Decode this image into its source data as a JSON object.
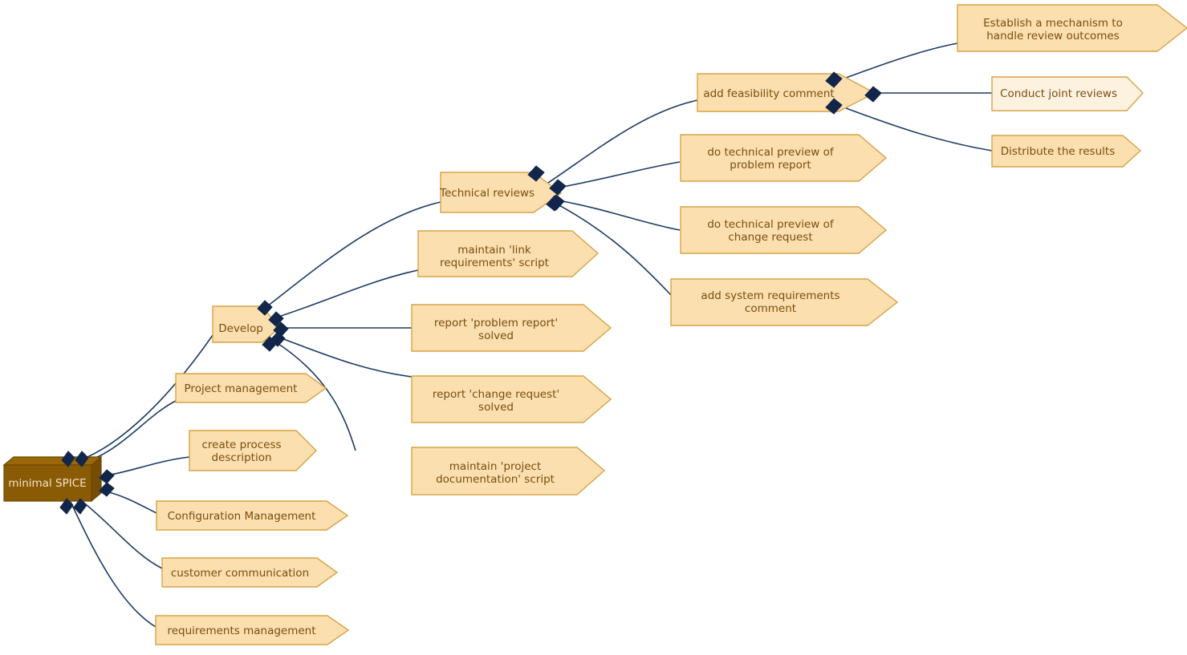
{
  "diagram": {
    "title": "minimal SPICE",
    "type": "work-breakdown-structure",
    "colors": {
      "leaf_fill": "#FBDFAF",
      "leaf_fill_light": "#FDF2E0",
      "leaf_stroke": "#D6A447",
      "leaf_text": "#7A4E10",
      "root_fill": "#8A5B05",
      "root_text": "#F3E3C8",
      "edge": "#1B3A63",
      "connector_diamond": "#12264B",
      "background": "#FFFFFF"
    },
    "nodes": {
      "root": {
        "label": "minimal SPICE"
      },
      "develop": {
        "label": "Develop"
      },
      "project_management": {
        "label": "Project management"
      },
      "create_process_description": {
        "line1": "create process",
        "line2": "description"
      },
      "configuration_management": {
        "label": "Configuration Management"
      },
      "customer_communication": {
        "label": "customer communication"
      },
      "requirements_management": {
        "label": "requirements management"
      },
      "technical_reviews": {
        "label": "Technical reviews"
      },
      "maintain_link_requirements": {
        "line1": "maintain 'link",
        "line2": "requirements' script"
      },
      "report_problem_report_solved": {
        "line1": "report 'problem report'",
        "line2": "solved"
      },
      "report_change_request_solved": {
        "line1": "report 'change request'",
        "line2": "solved"
      },
      "maintain_project_documentation": {
        "line1": "maintain 'project",
        "line2": "documentation' script"
      },
      "add_feasibility_comment": {
        "label": "add feasibility comment"
      },
      "do_technical_preview_problem_report": {
        "line1": "do technical preview of",
        "line2": "problem report"
      },
      "do_technical_preview_change_request": {
        "line1": "do technical preview of",
        "line2": "change request"
      },
      "add_system_requirements_comment": {
        "line1": "add system requirements",
        "line2": "comment"
      },
      "establish_mechanism": {
        "line1": "Establish a mechanism to",
        "line2": "handle review outcomes"
      },
      "conduct_joint_reviews": {
        "label": "Conduct joint reviews"
      },
      "distribute_results": {
        "label": "Distribute the results"
      }
    }
  }
}
